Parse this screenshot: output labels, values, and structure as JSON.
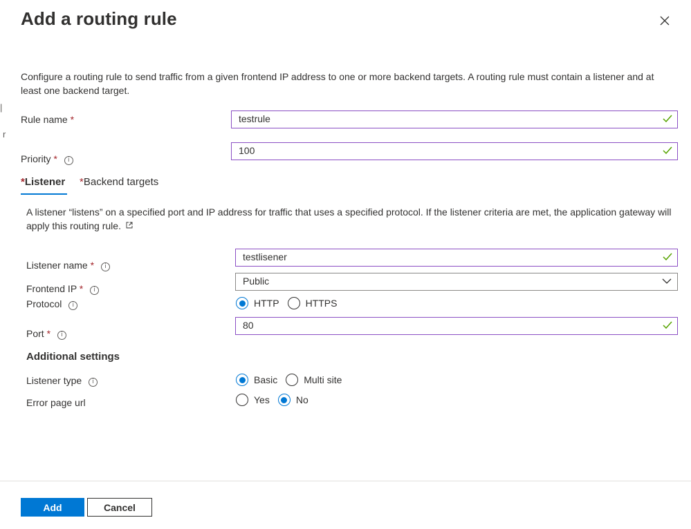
{
  "panel": {
    "title": "Add a routing rule",
    "intro": "Configure a routing rule to send traffic from a given frontend IP address to one or more backend targets. A routing rule must contain a listener and at least one backend target."
  },
  "edge_marks": {
    "char": "r"
  },
  "rule": {
    "name_label": "Rule name",
    "name_value": "testrule",
    "priority_label": "Priority",
    "priority_value": "100",
    "required_mark": "*",
    "info_glyph": "i"
  },
  "tabs": [
    {
      "label": "Listener",
      "active": true
    },
    {
      "label": "Backend targets",
      "active": false
    }
  ],
  "listener": {
    "description": "A listener “listens” on a specified port and IP address for traffic that uses a specified protocol. If the listener criteria are met, the application gateway will apply this routing rule.",
    "name_label": "Listener name",
    "name_value": "testlisener",
    "frontend_ip_label": "Frontend IP",
    "frontend_ip_value": "Public",
    "protocol_label": "Protocol",
    "protocol_options": [
      "HTTP",
      "HTTPS"
    ],
    "protocol_selected": "HTTP",
    "port_label": "Port",
    "port_value": "80"
  },
  "additional": {
    "heading": "Additional settings",
    "listener_type_label": "Listener type",
    "listener_type_options": [
      "Basic",
      "Multi site"
    ],
    "listener_type_selected": "Basic",
    "error_page_label": "Error page url",
    "error_page_options": [
      "Yes",
      "No"
    ],
    "error_page_selected": "No"
  },
  "footer": {
    "add_label": "Add",
    "cancel_label": "Cancel"
  },
  "colors": {
    "accent": "#0078d4",
    "valid_border": "#8a4ec4",
    "check": "#57a300",
    "required": "#a4262c"
  },
  "icons": {
    "close": "close-icon",
    "check": "checkmark-icon",
    "info": "info-icon",
    "external": "external-link-icon",
    "dropdown": "chevron-down-icon"
  }
}
